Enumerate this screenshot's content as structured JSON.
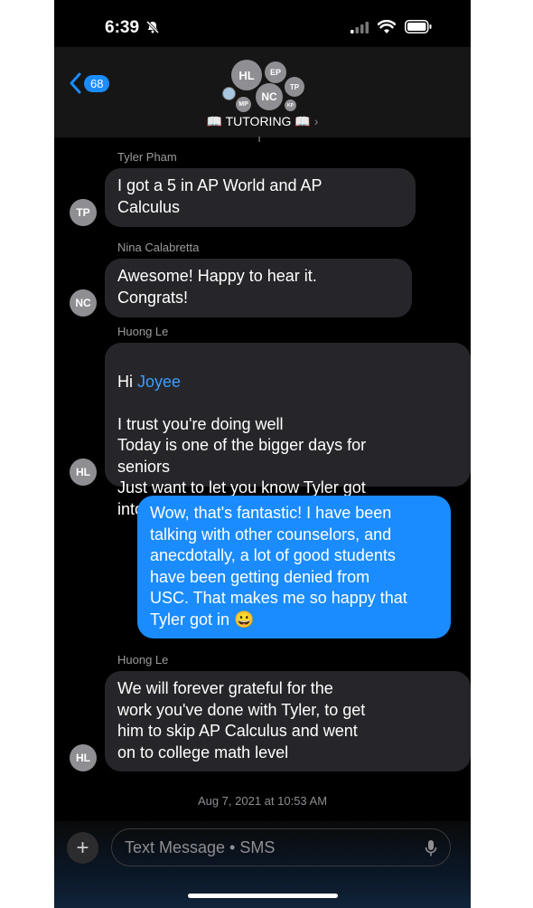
{
  "status": {
    "time": "6:39"
  },
  "header": {
    "back_count": "68",
    "group_name": "📖 TUTORING 📖",
    "avatars": [
      "HL",
      "EP",
      "TP",
      "NC",
      "MP",
      "KP"
    ]
  },
  "messages": [
    {
      "sender": "Tyler Pham",
      "avatar": "TP",
      "text": "I got a 5 in AP World and AP\nCalculus"
    },
    {
      "sender": "Nina Calabretta",
      "avatar": "NC",
      "text": "Awesome! Happy to hear it.\nCongrats!"
    },
    {
      "sender": "Huong Le",
      "avatar": "HL",
      "greeting": "Hi ",
      "mention": "Joyee",
      "text": "I trust you're doing well\nToday is one of the bigger days for\nseniors\nJust want to let you know Tyler got\ninto USC"
    },
    {
      "text": "Wow, that's fantastic! I have been\ntalking with other counselors, and\nanecdotally, a lot of good students\nhave been getting denied from\nUSC. That makes me so happy that\nTyler got in 😀"
    },
    {
      "sender": "Huong Le",
      "avatar": "HL",
      "text": "We will forever grateful for the\nwork you've done with Tyler, to get\nhim to skip AP Calculus and went\non to college math level"
    }
  ],
  "timestamp": "Aug 7, 2021 at 10:53 AM",
  "composer": {
    "placeholder": "Text Message • SMS"
  }
}
